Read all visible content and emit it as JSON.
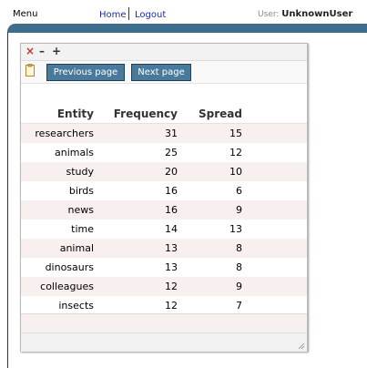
{
  "topbar": {
    "menu": "Menu",
    "home": "Home",
    "logout": "Logout",
    "user_label": "User:",
    "user_name": "UnknownUser"
  },
  "panel": {
    "prev_label": "Previous page",
    "next_label": "Next page"
  },
  "table": {
    "headers": {
      "entity": "Entity",
      "frequency": "Frequency",
      "spread": "Spread"
    },
    "rows": [
      {
        "entity": "researchers",
        "frequency": "31",
        "spread": "15"
      },
      {
        "entity": "animals",
        "frequency": "25",
        "spread": "12"
      },
      {
        "entity": "study",
        "frequency": "20",
        "spread": "10"
      },
      {
        "entity": "birds",
        "frequency": "16",
        "spread": "6"
      },
      {
        "entity": "news",
        "frequency": "16",
        "spread": "9"
      },
      {
        "entity": "time",
        "frequency": "14",
        "spread": "13"
      },
      {
        "entity": "animal",
        "frequency": "13",
        "spread": "8"
      },
      {
        "entity": "dinosaurs",
        "frequency": "13",
        "spread": "8"
      },
      {
        "entity": "colleagues",
        "frequency": "12",
        "spread": "9"
      },
      {
        "entity": "insects",
        "frequency": "12",
        "spread": "7"
      }
    ]
  },
  "colors": {
    "accent": "#3f6e8c",
    "button": "#4a7a9b",
    "link": "#1a2fa8",
    "row_alt": "#f8efef"
  },
  "icons": {
    "close": "close-icon",
    "minimize": "minimize-icon",
    "maximize": "plus-icon",
    "clipboard": "clipboard-icon",
    "resize": "resize-grip-icon"
  }
}
